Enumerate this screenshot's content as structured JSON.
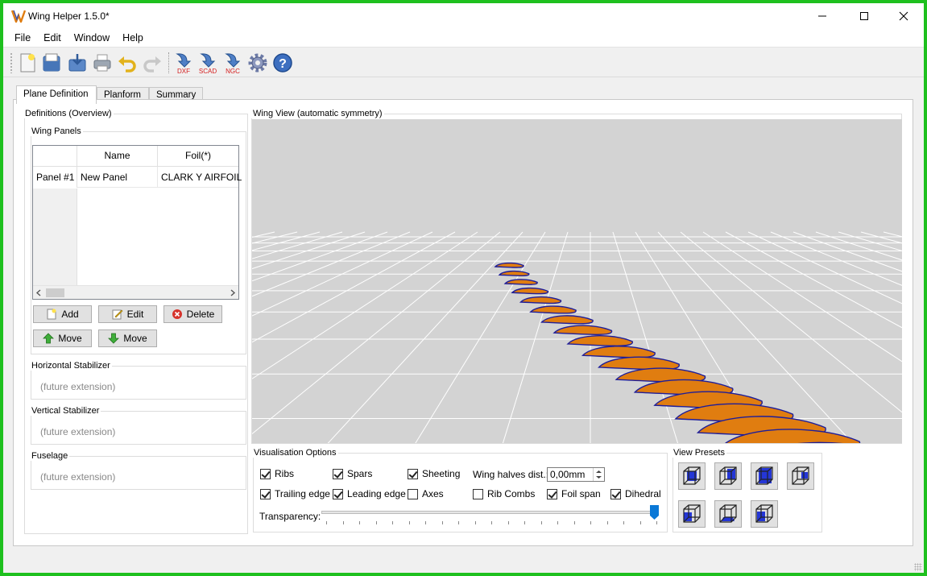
{
  "window": {
    "title": "Wing Helper 1.5.0*",
    "minimize_icon": "minimize-icon",
    "maximize_icon": "maximize-icon",
    "close_icon": "close-icon"
  },
  "menu": [
    "File",
    "Edit",
    "Window",
    "Help"
  ],
  "toolbar": {
    "export_labels": {
      "dxf": "DXF",
      "scad": "SCAD",
      "ngc": "NGC"
    },
    "icons": [
      "new-file-icon",
      "open-icon",
      "save-icon",
      "print-icon",
      "undo-icon",
      "redo-icon",
      "export-dxf-icon",
      "export-scad-icon",
      "export-ngc-icon",
      "settings-icon",
      "help-icon"
    ]
  },
  "tabs": [
    "Plane Definition",
    "Planform",
    "Summary"
  ],
  "definitions": {
    "title": "Definitions (Overview)",
    "wing_panels": {
      "title": "Wing Panels",
      "columns": [
        "Name",
        "Foil(*)"
      ],
      "rows": [
        {
          "header": "Panel #1",
          "name": "New Panel",
          "foil": "CLARK Y AIRFOIL"
        }
      ],
      "buttons": {
        "add": "Add",
        "edit": "Edit",
        "delete": "Delete",
        "move_up": "Move",
        "move_down": "Move"
      }
    },
    "horizontal_stabilizer": {
      "title": "Horizontal Stabilizer",
      "placeholder": "(future extension)"
    },
    "vertical_stabilizer": {
      "title": "Vertical Stabilizer",
      "placeholder": "(future extension)"
    },
    "fuselage": {
      "title": "Fuselage",
      "placeholder": "(future extension)"
    }
  },
  "wing_view": {
    "title": "Wing View (automatic symmetry)",
    "colors": {
      "background": "#d3d3d3",
      "grid": "#ffffff",
      "rib_fill": "#e07d10",
      "rib_outline": "#1e1e9a"
    }
  },
  "visualisation": {
    "title": "Visualisation Options",
    "options": [
      {
        "label": "Ribs",
        "checked": true
      },
      {
        "label": "Spars",
        "checked": true
      },
      {
        "label": "Sheeting",
        "checked": true
      },
      {
        "label": "Trailing edge",
        "checked": true
      },
      {
        "label": "Leading edge",
        "checked": true
      },
      {
        "label": "Axes",
        "checked": false
      },
      {
        "label": "Rib Combs",
        "checked": false
      },
      {
        "label": "Foil span",
        "checked": true
      },
      {
        "label": "Dihedral",
        "checked": true
      }
    ],
    "wing_halves_label": "Wing halves dist.:",
    "wing_halves_value": "0,00mm",
    "transparency_label": "Transparency:",
    "transparency_value": 1.0
  },
  "view_presets": {
    "title": "View Presets",
    "presets": [
      "view-preset-front-icon",
      "view-preset-right-icon",
      "view-preset-top-icon",
      "view-preset-back-icon",
      "view-preset-left-icon",
      "view-preset-bottom-icon",
      "view-preset-iso-icon"
    ]
  }
}
